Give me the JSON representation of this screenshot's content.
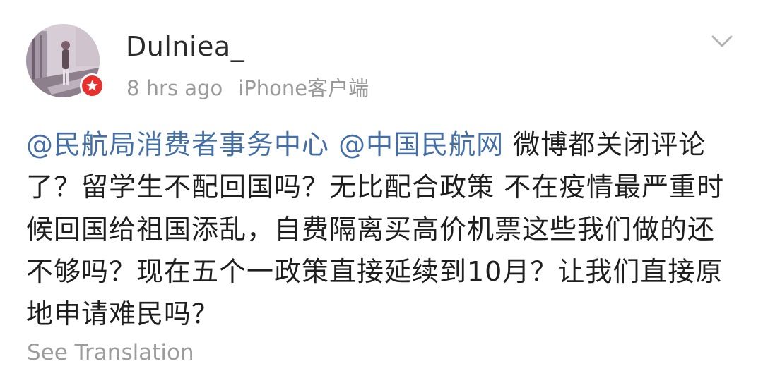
{
  "post": {
    "username": "Dulniea_",
    "time": "8 hrs ago",
    "source": "iPhone客户端",
    "mention_1": "@民航局消费者事务中心",
    "mention_2": "@中国民航网",
    "text_after_mentions": " 微博都关闭评论了？留学生不配回国吗？无比配合政策 不在疫情最严重时候回国给祖国添乱，自费隔离买高价机票这些我们做的还不够吗？现在五个一政策直接延续到10月？让我们直接原地申请难民吗？",
    "see_translation": "See Translation"
  },
  "icons": {
    "avatar": "user-avatar",
    "badge": "star-badge-icon",
    "menu": "chevron-down-icon"
  },
  "colors": {
    "mention": "#436ea6",
    "badge": "#e8312f",
    "meta": "#9a9a9a"
  }
}
